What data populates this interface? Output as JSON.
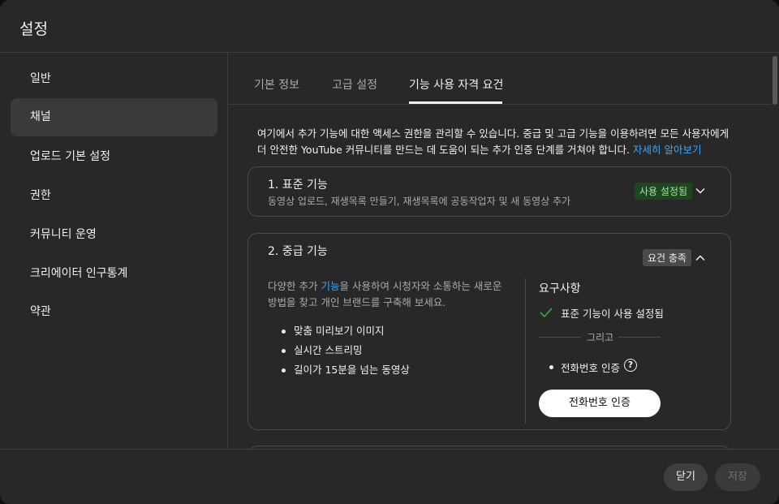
{
  "dialog": {
    "title": "설정"
  },
  "sidebar": {
    "items": [
      {
        "label": "일반"
      },
      {
        "label": "채널",
        "active": true
      },
      {
        "label": "업로드 기본 설정"
      },
      {
        "label": "권한"
      },
      {
        "label": "커뮤니티 운영"
      },
      {
        "label": "크리에이터 인구통계"
      },
      {
        "label": "약관"
      }
    ]
  },
  "tabs": [
    {
      "label": "기본 정보"
    },
    {
      "label": "고급 설정"
    },
    {
      "label": "기능 사용 자격 요건",
      "active": true
    }
  ],
  "intro": {
    "text": "여기에서 추가 기능에 대한 액세스 권한을 관리할 수 있습니다. 중급 및 고급 기능을 이용하려면 모든 사용자에게 더 안전한 YouTube 커뮤니티를 만드는 데 도움이 되는 추가 인증 단계를 거쳐야 합니다.",
    "link": "자세히 알아보기"
  },
  "card1": {
    "title": "1. 표준 기능",
    "subtitle": "동영상 업로드, 재생목록 만들기, 재생목록에 공동작업자 및 새 동영상 추가",
    "badge": "사용 설정됨",
    "icon": "chevron-down-icon"
  },
  "card2": {
    "title": "2. 중급 기능",
    "badge": "요건 충족",
    "icon": "chevron-up-icon",
    "desc_before": "다양한 추가 ",
    "desc_link": "기능",
    "desc_after": "을 사용하여 시청자와 소통하는 새로운 방법을 찾고 개인 브랜드를 구축해 보세요.",
    "features": [
      "맞춤 미리보기 이미지",
      "실시간 스트리밍",
      "길이가 15분을 넘는 동영상"
    ],
    "requirements_title": "요구사항",
    "requirement_met": "표준 기능이 사용 설정됨",
    "separator": "그리고",
    "requirement_2": "전화번호 인증",
    "verify_button": "전화번호 인증"
  },
  "footer": {
    "close_label": "닫기",
    "save_label": "저장"
  },
  "colors": {
    "background": "#282828",
    "accent_link": "#3ea6ff",
    "badge_green_bg": "#1e4620",
    "badge_green_text": "#a6e3a1",
    "check": "#2ba640"
  }
}
